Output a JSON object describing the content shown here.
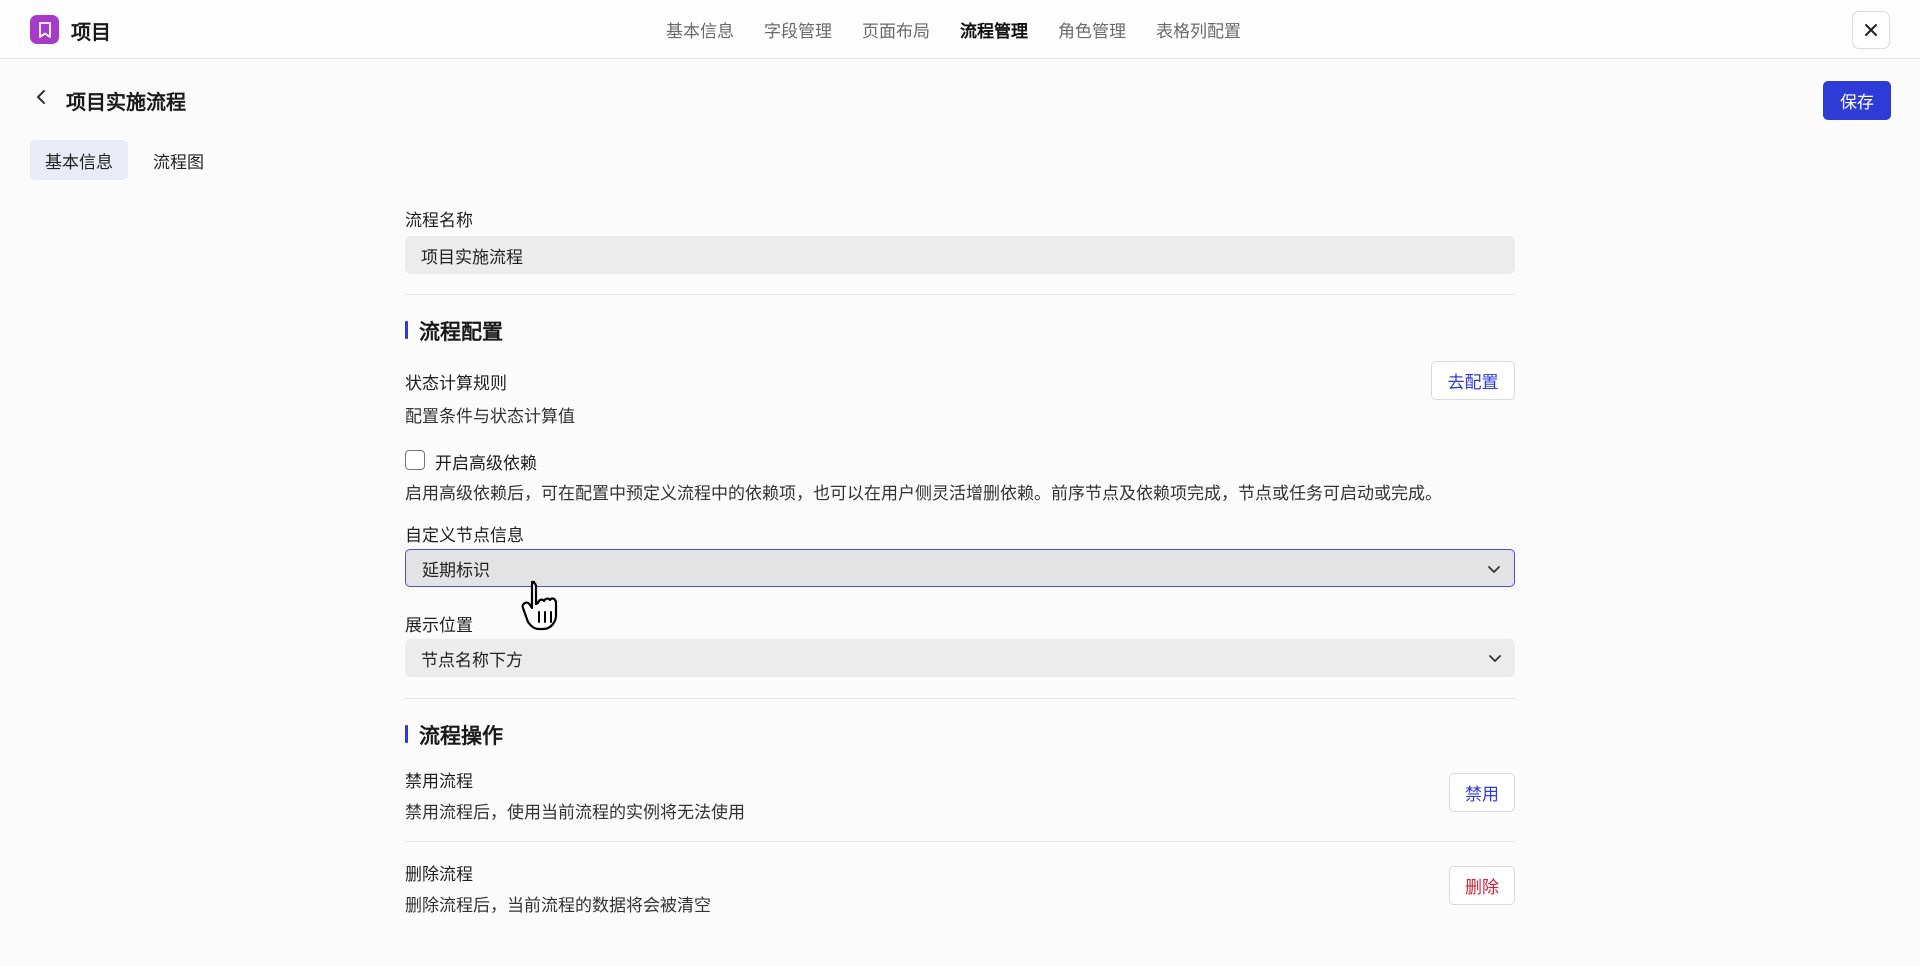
{
  "app": {
    "title": "项目"
  },
  "topnav": {
    "items": [
      {
        "label": "基本信息",
        "active": false
      },
      {
        "label": "字段管理",
        "active": false
      },
      {
        "label": "页面布局",
        "active": false
      },
      {
        "label": "流程管理",
        "active": true
      },
      {
        "label": "角色管理",
        "active": false
      },
      {
        "label": "表格列配置",
        "active": false
      }
    ]
  },
  "header": {
    "title": "项目实施流程",
    "save_label": "保存"
  },
  "tabs": [
    {
      "label": "基本信息",
      "active": true
    },
    {
      "label": "流程图",
      "active": false
    }
  ],
  "form": {
    "name_label": "流程名称",
    "name_value": "项目实施流程"
  },
  "config": {
    "section_title": "流程配置",
    "status_rule_label": "状态计算规则",
    "status_rule_desc": "配置条件与状态计算值",
    "status_rule_button": "去配置",
    "advanced_dep_label": "开启高级依赖",
    "advanced_dep_checked": false,
    "advanced_dep_desc": "启用高级依赖后，可在配置中预定义流程中的依赖项，也可以在用户侧灵活增删依赖。前序节点及依赖项完成，节点或任务可启动或完成。",
    "custom_node_label": "自定义节点信息",
    "custom_node_value": "延期标识",
    "position_label": "展示位置",
    "position_value": "节点名称下方"
  },
  "operations": {
    "section_title": "流程操作",
    "disable_label": "禁用流程",
    "disable_desc": "禁用流程后，使用当前流程的实例将无法使用",
    "disable_button": "禁用",
    "delete_label": "删除流程",
    "delete_desc": "删除流程后，当前流程的数据将会被清空",
    "delete_button": "删除"
  },
  "colors": {
    "accent": "#2f3bd6",
    "danger": "#d0203a",
    "app_icon": "#a53bc8"
  }
}
